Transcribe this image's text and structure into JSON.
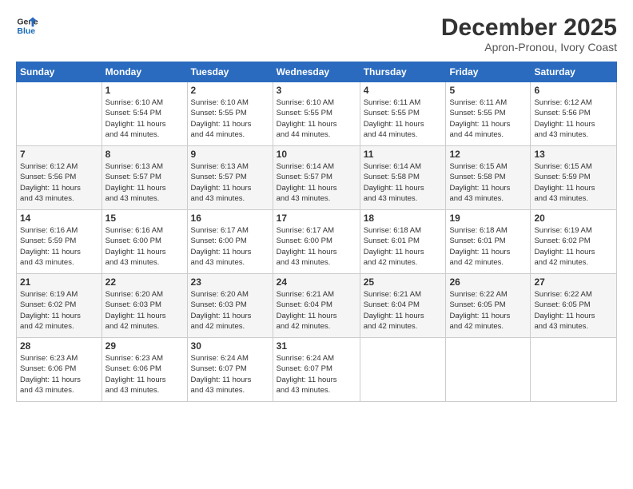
{
  "logo": {
    "line1": "General",
    "line2": "Blue"
  },
  "title": "December 2025",
  "subtitle": "Apron-Pronou, Ivory Coast",
  "weekdays": [
    "Sunday",
    "Monday",
    "Tuesday",
    "Wednesday",
    "Thursday",
    "Friday",
    "Saturday"
  ],
  "weeks": [
    [
      {
        "day": "",
        "info": ""
      },
      {
        "day": "1",
        "info": "Sunrise: 6:10 AM\nSunset: 5:54 PM\nDaylight: 11 hours\nand 44 minutes."
      },
      {
        "day": "2",
        "info": "Sunrise: 6:10 AM\nSunset: 5:55 PM\nDaylight: 11 hours\nand 44 minutes."
      },
      {
        "day": "3",
        "info": "Sunrise: 6:10 AM\nSunset: 5:55 PM\nDaylight: 11 hours\nand 44 minutes."
      },
      {
        "day": "4",
        "info": "Sunrise: 6:11 AM\nSunset: 5:55 PM\nDaylight: 11 hours\nand 44 minutes."
      },
      {
        "day": "5",
        "info": "Sunrise: 6:11 AM\nSunset: 5:55 PM\nDaylight: 11 hours\nand 44 minutes."
      },
      {
        "day": "6",
        "info": "Sunrise: 6:12 AM\nSunset: 5:56 PM\nDaylight: 11 hours\nand 43 minutes."
      }
    ],
    [
      {
        "day": "7",
        "info": "Sunrise: 6:12 AM\nSunset: 5:56 PM\nDaylight: 11 hours\nand 43 minutes."
      },
      {
        "day": "8",
        "info": "Sunrise: 6:13 AM\nSunset: 5:57 PM\nDaylight: 11 hours\nand 43 minutes."
      },
      {
        "day": "9",
        "info": "Sunrise: 6:13 AM\nSunset: 5:57 PM\nDaylight: 11 hours\nand 43 minutes."
      },
      {
        "day": "10",
        "info": "Sunrise: 6:14 AM\nSunset: 5:57 PM\nDaylight: 11 hours\nand 43 minutes."
      },
      {
        "day": "11",
        "info": "Sunrise: 6:14 AM\nSunset: 5:58 PM\nDaylight: 11 hours\nand 43 minutes."
      },
      {
        "day": "12",
        "info": "Sunrise: 6:15 AM\nSunset: 5:58 PM\nDaylight: 11 hours\nand 43 minutes."
      },
      {
        "day": "13",
        "info": "Sunrise: 6:15 AM\nSunset: 5:59 PM\nDaylight: 11 hours\nand 43 minutes."
      }
    ],
    [
      {
        "day": "14",
        "info": "Sunrise: 6:16 AM\nSunset: 5:59 PM\nDaylight: 11 hours\nand 43 minutes."
      },
      {
        "day": "15",
        "info": "Sunrise: 6:16 AM\nSunset: 6:00 PM\nDaylight: 11 hours\nand 43 minutes."
      },
      {
        "day": "16",
        "info": "Sunrise: 6:17 AM\nSunset: 6:00 PM\nDaylight: 11 hours\nand 43 minutes."
      },
      {
        "day": "17",
        "info": "Sunrise: 6:17 AM\nSunset: 6:00 PM\nDaylight: 11 hours\nand 43 minutes."
      },
      {
        "day": "18",
        "info": "Sunrise: 6:18 AM\nSunset: 6:01 PM\nDaylight: 11 hours\nand 42 minutes."
      },
      {
        "day": "19",
        "info": "Sunrise: 6:18 AM\nSunset: 6:01 PM\nDaylight: 11 hours\nand 42 minutes."
      },
      {
        "day": "20",
        "info": "Sunrise: 6:19 AM\nSunset: 6:02 PM\nDaylight: 11 hours\nand 42 minutes."
      }
    ],
    [
      {
        "day": "21",
        "info": "Sunrise: 6:19 AM\nSunset: 6:02 PM\nDaylight: 11 hours\nand 42 minutes."
      },
      {
        "day": "22",
        "info": "Sunrise: 6:20 AM\nSunset: 6:03 PM\nDaylight: 11 hours\nand 42 minutes."
      },
      {
        "day": "23",
        "info": "Sunrise: 6:20 AM\nSunset: 6:03 PM\nDaylight: 11 hours\nand 42 minutes."
      },
      {
        "day": "24",
        "info": "Sunrise: 6:21 AM\nSunset: 6:04 PM\nDaylight: 11 hours\nand 42 minutes."
      },
      {
        "day": "25",
        "info": "Sunrise: 6:21 AM\nSunset: 6:04 PM\nDaylight: 11 hours\nand 42 minutes."
      },
      {
        "day": "26",
        "info": "Sunrise: 6:22 AM\nSunset: 6:05 PM\nDaylight: 11 hours\nand 42 minutes."
      },
      {
        "day": "27",
        "info": "Sunrise: 6:22 AM\nSunset: 6:05 PM\nDaylight: 11 hours\nand 43 minutes."
      }
    ],
    [
      {
        "day": "28",
        "info": "Sunrise: 6:23 AM\nSunset: 6:06 PM\nDaylight: 11 hours\nand 43 minutes."
      },
      {
        "day": "29",
        "info": "Sunrise: 6:23 AM\nSunset: 6:06 PM\nDaylight: 11 hours\nand 43 minutes."
      },
      {
        "day": "30",
        "info": "Sunrise: 6:24 AM\nSunset: 6:07 PM\nDaylight: 11 hours\nand 43 minutes."
      },
      {
        "day": "31",
        "info": "Sunrise: 6:24 AM\nSunset: 6:07 PM\nDaylight: 11 hours\nand 43 minutes."
      },
      {
        "day": "",
        "info": ""
      },
      {
        "day": "",
        "info": ""
      },
      {
        "day": "",
        "info": ""
      }
    ]
  ]
}
